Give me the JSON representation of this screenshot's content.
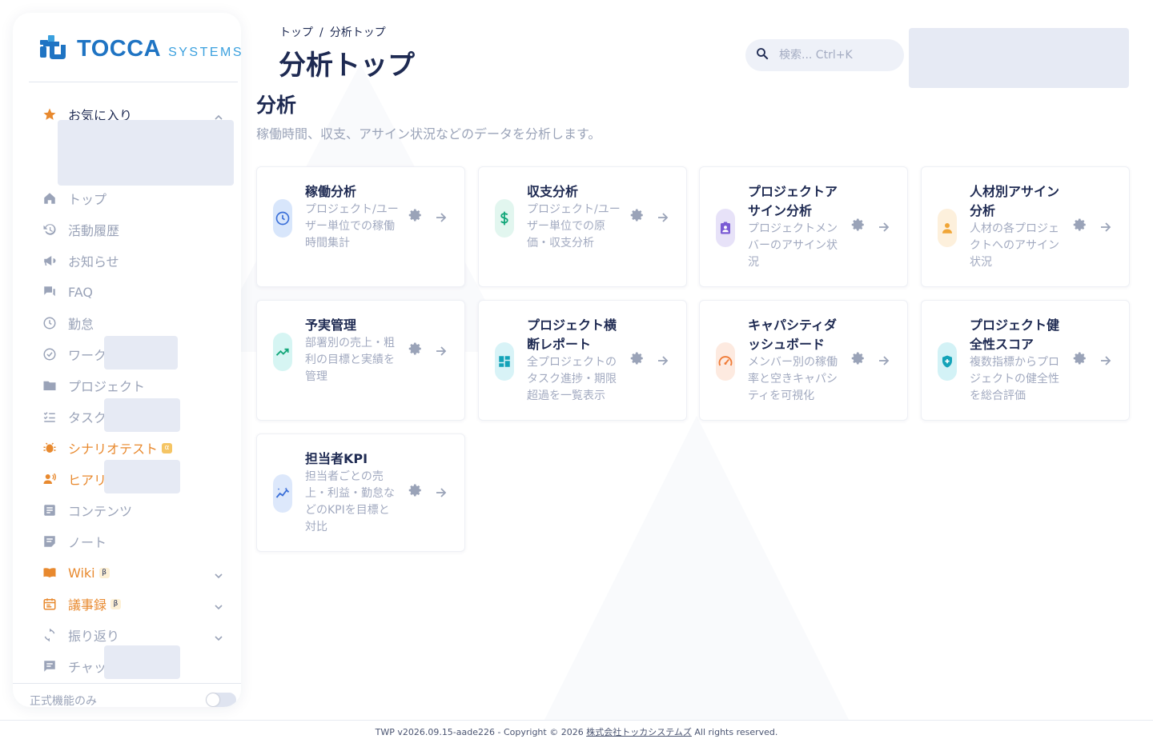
{
  "brand": {
    "name_main": "TOCCA",
    "name_sub": "SYSTEMS"
  },
  "sidebar": {
    "favorites_label": "お気に入り",
    "items": [
      {
        "label": "トップ",
        "icon": "home-icon"
      },
      {
        "label": "活動履歴",
        "icon": "history-icon"
      },
      {
        "label": "お知らせ",
        "icon": "megaphone-icon"
      },
      {
        "label": "FAQ",
        "icon": "forum-icon"
      },
      {
        "label": "勤怠",
        "icon": "clock-icon"
      },
      {
        "label": "ワーク",
        "icon": "check-circle-icon"
      },
      {
        "label": "プロジェクト",
        "icon": "folder-icon"
      },
      {
        "label": "タスク",
        "icon": "checklist-icon"
      },
      {
        "label": "シナリオテスト",
        "icon": "bug-icon",
        "badge": "α"
      },
      {
        "label": "ヒアリ",
        "icon": "interview-icon"
      },
      {
        "label": "コンテンツ",
        "icon": "article-icon"
      },
      {
        "label": "ノート",
        "icon": "note-icon"
      },
      {
        "label": "Wiki",
        "icon": "book-icon",
        "badge": "β"
      },
      {
        "label": "議事録",
        "icon": "calendar-icon",
        "badge": "β"
      },
      {
        "label": "振り返り",
        "icon": "refresh-icon"
      },
      {
        "label": "チャッ",
        "icon": "chat-icon"
      }
    ],
    "footer_label": "正式機能のみ"
  },
  "header": {
    "breadcrumb": [
      "トップ",
      "分析トップ"
    ],
    "breadcrumb_sep": "/",
    "title": "分析トップ",
    "search_placeholder": "検索... Ctrl+K"
  },
  "section": {
    "title": "分析",
    "description": "稼働時間、収支、アサイン状況などのデータを分析します。"
  },
  "cards": [
    {
      "title": "稼働分析",
      "desc": "プロジェクト/ユーザー単位での稼働時間集計",
      "icon": "clock-icon",
      "color": "#3a6fd8",
      "bg": "#d8e6fb"
    },
    {
      "title": "収支分析",
      "desc": "プロジェクト/ユーザー単位での原価・収支分析",
      "icon": "dollar-icon",
      "color": "#14a77a",
      "bg": "#e2f6ef"
    },
    {
      "title": "プロジェクトアサイン分析",
      "desc": "プロジェクトメンバーのアサイン状況",
      "icon": "assignment-ind-icon",
      "color": "#7a5bd4",
      "bg": "#e7e2f8"
    },
    {
      "title": "人材別アサイン分析",
      "desc": "人材の各プロジェクトへのアサイン状況",
      "icon": "person-icon",
      "color": "#f0a536",
      "bg": "#fdf0dc"
    },
    {
      "title": "予実管理",
      "desc": "部署別の売上・粗利の目標と実績を管理",
      "icon": "trending-up-icon",
      "color": "#14a77a",
      "bg": "#d6f5f3"
    },
    {
      "title": "プロジェクト横断レポート",
      "desc": "全プロジェクトのタスク進捗・期限超過を一覧表示",
      "icon": "dashboard-icon",
      "color": "#14a3b8",
      "bg": "#d8f3f7"
    },
    {
      "title": "キャパシティダッシュボード",
      "desc": "メンバー別の稼働率と空きキャパシティを可視化",
      "icon": "speed-icon",
      "color": "#f07b36",
      "bg": "#fdeae0"
    },
    {
      "title": "プロジェクト健全性スコア",
      "desc": "複数指標からプロジェクトの健全性を総合評価",
      "icon": "health-shield-icon",
      "color": "#14a3b8",
      "bg": "#d3f2f6"
    },
    {
      "title": "担当者KPI",
      "desc": "担当者ごとの売上・利益・勤怠などのKPIを目標と対比",
      "icon": "insights-icon",
      "color": "#3a6fd8",
      "bg": "#dde8fb"
    }
  ],
  "footer": {
    "prefix": "TWP v2026.09.15-aade226 - Copyright © 2026 ",
    "company": "株式会社トッカシステムズ",
    "suffix": " All rights reserved."
  }
}
